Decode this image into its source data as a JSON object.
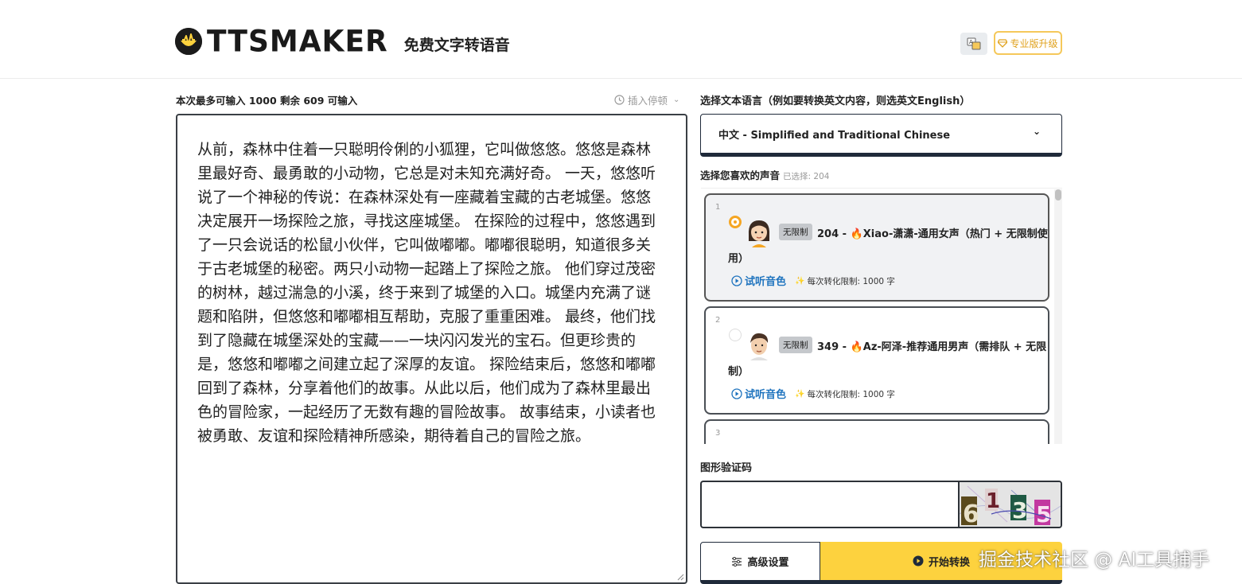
{
  "header": {
    "logo_text": "TTSMAKER",
    "logo_subtitle": "免费文字转语音",
    "pro_button_label": "专业版升级"
  },
  "editor": {
    "limit_text": "本次最多可输入 1000 剩余 609 可输入",
    "insert_pause_label": "插入停顿",
    "content": "从前，森林中住着一只聪明伶俐的小狐狸，它叫做悠悠。悠悠是森林里最好奇、最勇敢的小动物，它总是对未知充满好奇。 一天，悠悠听说了一个神秘的传说：在森林深处有一座藏着宝藏的古老城堡。悠悠决定展开一场探险之旅，寻找这座城堡。 在探险的过程中，悠悠遇到了一只会说话的松鼠小伙伴，它叫做嘟嘟。嘟嘟很聪明，知道很多关于古老城堡的秘密。两只小动物一起踏上了探险之旅。 他们穿过茂密的树林，越过湍急的小溪，终于来到了城堡的入口。城堡内充满了谜题和陷阱，但悠悠和嘟嘟相互帮助，克服了重重困难。 最终，他们找到了隐藏在城堡深处的宝藏——一块闪闪发光的宝石。但更珍贵的是，悠悠和嘟嘟之间建立起了深厚的友谊。 探险结束后，悠悠和嘟嘟回到了森林，分享着他们的故事。从此以后，他们成为了森林里最出色的冒险家，一起经历了无数有趣的冒险故事。 故事结束，小读者也被勇敢、友谊和探险精神所感染，期待着自己的冒险之旅。"
  },
  "language": {
    "label": "选择文本语言（例如要转换英文内容，则选英文English）",
    "selected": "中文 - Simplified and Traditional Chinese"
  },
  "voices": {
    "label": "选择您喜欢的声音",
    "selected_info": "已选择: 204",
    "items": [
      {
        "num": "1",
        "badge": "无限制",
        "title": "204 - 🔥Xiao-潇潇-通用女声（热门 + 无限制使用）",
        "listen_label": "试听音色",
        "limit": "每次转化限制: 1000 字",
        "selected": true
      },
      {
        "num": "2",
        "badge": "无限制",
        "title": "349 - 🔥Az-阿泽-推荐通用男声（需排队 + 无限制）",
        "listen_label": "试听音色",
        "limit": "每次转化限制: 1000 字",
        "selected": false
      },
      {
        "num": "3"
      }
    ]
  },
  "captcha": {
    "label": "图形验证码",
    "input_value": "",
    "image_chars": [
      "6",
      "1",
      "3",
      "5"
    ]
  },
  "actions": {
    "advanced_label": "高级设置",
    "start_label": "开始转换"
  },
  "watermark": "掘金技术社区 @ AI工具捕手",
  "colors": {
    "accent_yellow": "#fdd23e",
    "dark_border": "#1f2a3a",
    "link_blue": "#1e73be",
    "radio_orange": "#f5a623"
  }
}
